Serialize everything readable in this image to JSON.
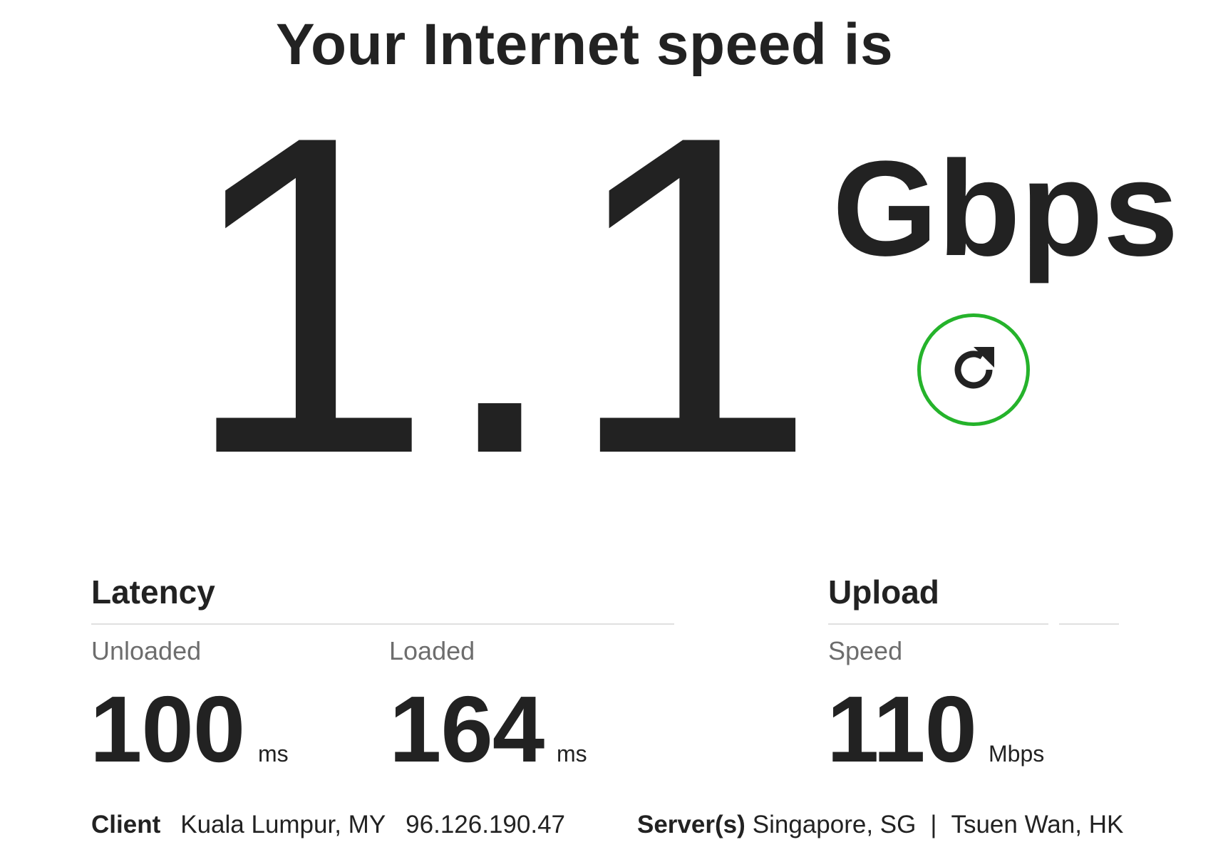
{
  "heading": "Your Internet speed is",
  "speed": {
    "value": "1.1",
    "units": "Gbps"
  },
  "refresh": {
    "icon": "refresh-icon",
    "accent_color": "#25b32b"
  },
  "latency": {
    "title": "Latency",
    "unloaded": {
      "label": "Unloaded",
      "value": "100",
      "unit": "ms"
    },
    "loaded": {
      "label": "Loaded",
      "value": "164",
      "unit": "ms"
    }
  },
  "upload": {
    "title": "Upload",
    "speed": {
      "label": "Speed",
      "value": "110",
      "unit": "Mbps"
    }
  },
  "client": {
    "label": "Client",
    "location": "Kuala Lumpur, MY",
    "ip": "96.126.190.47"
  },
  "servers": {
    "label": "Server(s)",
    "list": "Singapore, SG",
    "separator": "|",
    "list2": "Tsuen Wan, HK"
  }
}
